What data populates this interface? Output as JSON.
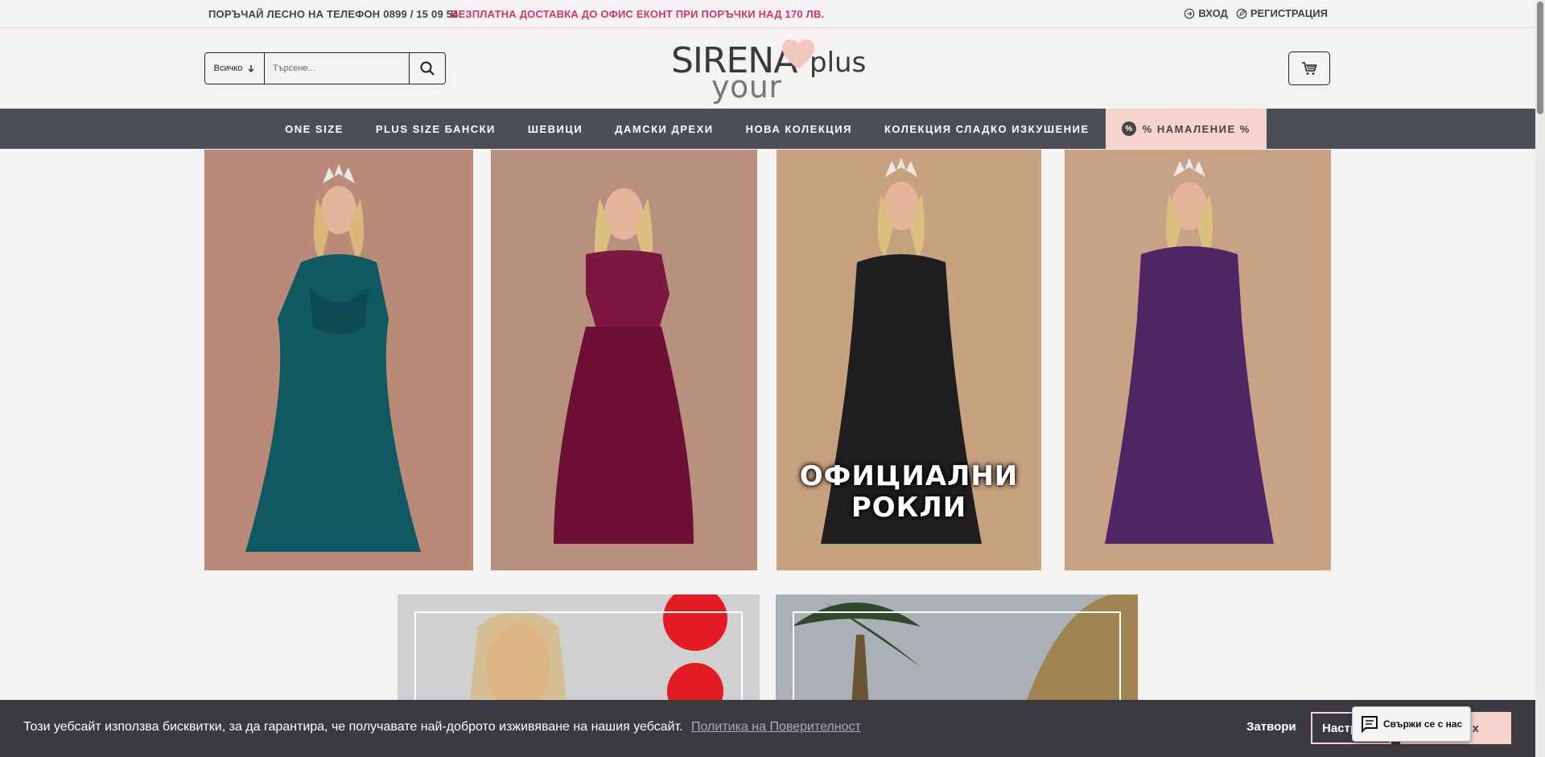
{
  "topbar": {
    "phone": "ПОРЪЧАЙ ЛЕСНО НА ТЕЛЕФОН 0899 / 15 09 54",
    "promo": "БЕЗПЛАТНА ДОСТАВКА ДО ОФИС ЕКОНТ ПРИ ПОРЪЧКИ НАД 170 ЛВ.",
    "login": "ВХОД",
    "register": "РЕГИСТРАЦИЯ"
  },
  "header": {
    "search_category": "Всичко",
    "search_placeholder": "Търсене...",
    "logo_brand": "SIRENA",
    "logo_plus": "plus",
    "logo_tagline": "your body"
  },
  "nav": {
    "items": [
      "ONE SIZE",
      "PLUS SIZE БАНСКИ",
      "ШЕВИЦИ",
      "ДАМСКИ ДРЕХИ",
      "НОВА КОЛЕКЦИЯ",
      "КОЛЕКЦИЯ СЛАДКО ИЗКУШЕНИЕ"
    ],
    "sale_badge": "%",
    "sale": "% НАМАЛЕНИЕ %"
  },
  "tiles": {
    "overlay_line1": "ОФИЦИАЛНИ",
    "overlay_line2": "РОКЛИ"
  },
  "cookie": {
    "message": "Този уебсайт използва бисквитки, за да гарантира, че получавате най-доброто изживяване на нашия уебсайт.",
    "policy_link": "Политика на Поверителност",
    "close": "Затвори",
    "settings": "Настр",
    "accept": "х"
  },
  "chat": {
    "label": "Свържи се с нас"
  },
  "colors": {
    "accent_pink": "#d6336c",
    "nav_bg": "#4b4e57",
    "sale_bg": "#f6d3cd",
    "cookie_bg": "#3a3a40"
  }
}
